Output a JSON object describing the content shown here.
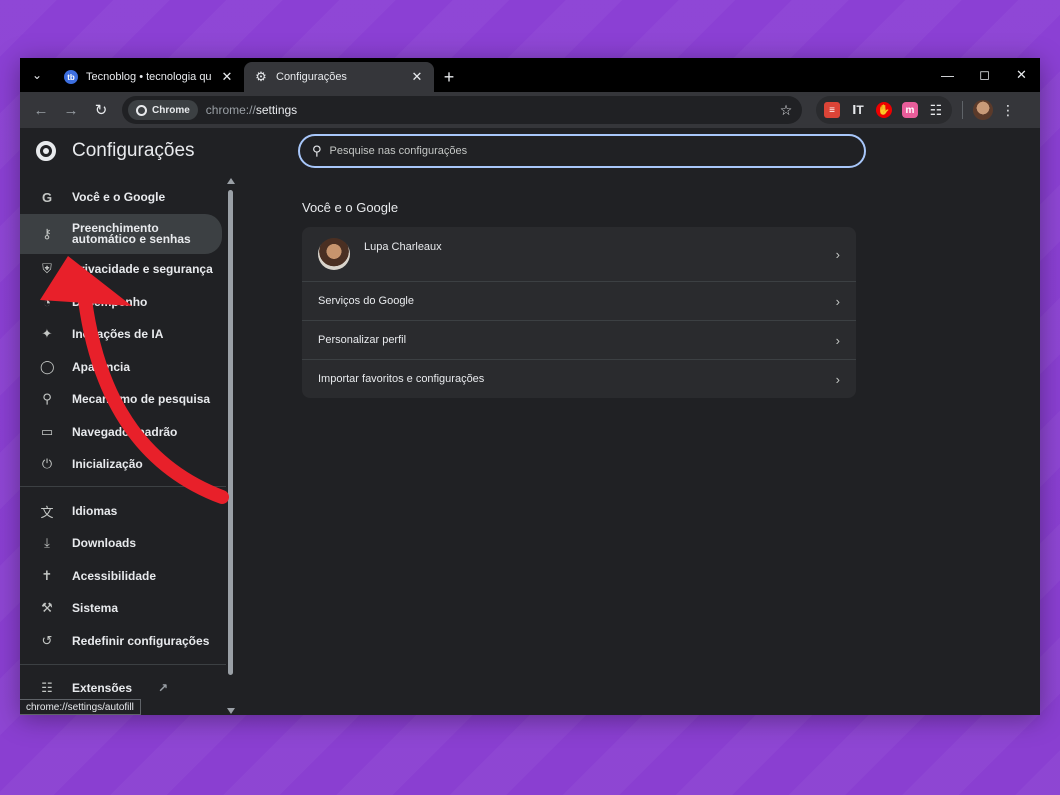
{
  "tabs": [
    {
      "title": "Tecnoblog • tecnologia que interessa",
      "favicon": "tecnoblog-icon",
      "active": false
    },
    {
      "title": "Configurações",
      "favicon": "gear-icon",
      "active": true
    }
  ],
  "toolbar": {
    "chip_label": "Chrome",
    "url_scheme": "chrome://",
    "url_path": "settings"
  },
  "settings": {
    "title": "Configurações",
    "search_placeholder": "Pesquise nas configurações",
    "nav": [
      {
        "label": "Você e o Google",
        "icon": "google-g-icon"
      },
      {
        "label_line1": "Preenchimento",
        "label_line2": "automático e senhas",
        "icon": "key-icon",
        "selected": true
      },
      {
        "label": "Privacidade e segurança",
        "icon": "shield-icon"
      },
      {
        "label": "Desempenho",
        "icon": "speedometer-icon"
      },
      {
        "label": "Inovações de IA",
        "icon": "sparkle-icon"
      },
      {
        "label": "Aparência",
        "icon": "palette-icon"
      },
      {
        "label": "Mecanismo de pesquisa",
        "icon": "search-icon"
      },
      {
        "label": "Navegador padrão",
        "icon": "browser-icon"
      },
      {
        "label": "Inicialização",
        "icon": "power-icon"
      },
      {
        "label": "Idiomas",
        "icon": "translate-icon"
      },
      {
        "label": "Downloads",
        "icon": "download-icon"
      },
      {
        "label": "Acessibilidade",
        "icon": "accessibility-icon"
      },
      {
        "label": "Sistema",
        "icon": "wrench-icon"
      },
      {
        "label": "Redefinir configurações",
        "icon": "reset-icon"
      },
      {
        "label": "Extensões",
        "icon": "puzzle-icon"
      }
    ],
    "section_title": "Você e o Google",
    "profile_name": "Lupa Charleaux",
    "rows": [
      "Serviços do Google",
      "Personalizar perfil",
      "Importar favoritos e configurações"
    ],
    "status_tip": "chrome://settings/autofill"
  },
  "colors": {
    "background": "#8a3fd1",
    "arrow": "#e8202a",
    "focus_ring": "#a8c7fa"
  }
}
